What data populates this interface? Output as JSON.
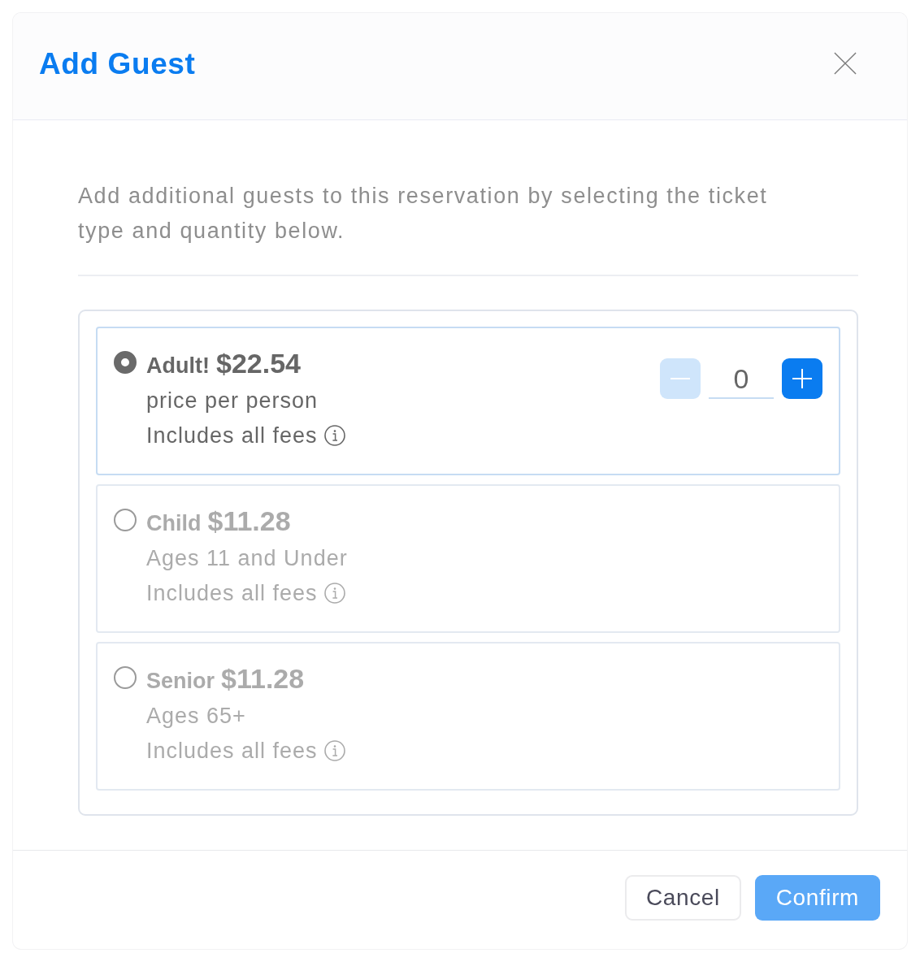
{
  "dialog": {
    "title": "Add Guest"
  },
  "description": "Add additional guests to this reservation by selecting the ticket type and quantity below.",
  "tickets": [
    {
      "name": "Adult!",
      "price": "$22.54",
      "subtitle": "price per person",
      "fees_note": "Includes all fees",
      "selected": true,
      "stepper": {
        "value": "0",
        "decrease_disabled": true,
        "increase_disabled": false
      }
    },
    {
      "name": "Child",
      "price": "$11.28",
      "subtitle": "Ages 11 and Under",
      "fees_note": "Includes all fees",
      "selected": false
    },
    {
      "name": "Senior",
      "price": "$11.28",
      "subtitle": "Ages 65+",
      "fees_note": "Includes all fees",
      "selected": false
    }
  ],
  "buttons": [
    {
      "label": "Cancel",
      "kind": "secondary",
      "disabled": false
    },
    {
      "label": "Confirm",
      "kind": "primary",
      "disabled": true
    }
  ]
}
